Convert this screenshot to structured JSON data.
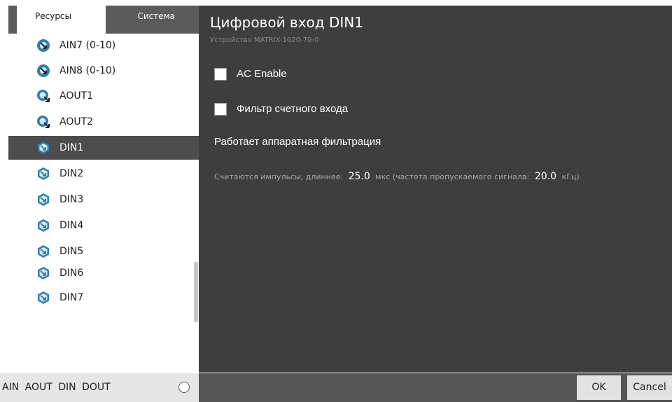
{
  "sidebar": {
    "tabs": [
      {
        "label": "Ресурсы",
        "active": true
      },
      {
        "label": "Система",
        "active": false
      }
    ],
    "items": [
      {
        "label": "AIN7 (0-10)",
        "icon": "analog-input-icon",
        "selected": false
      },
      {
        "label": "AIN8 (0-10)",
        "icon": "analog-input-icon",
        "selected": false
      },
      {
        "label": "AOUT1",
        "icon": "analog-output-icon",
        "selected": false
      },
      {
        "label": "AOUT2",
        "icon": "analog-output-icon",
        "selected": false
      },
      {
        "label": "DIN1",
        "icon": "digital-input-icon",
        "selected": true
      },
      {
        "label": "DIN2",
        "icon": "digital-input-icon",
        "selected": false
      },
      {
        "label": "DIN3",
        "icon": "digital-input-icon",
        "selected": false
      },
      {
        "label": "DIN4",
        "icon": "digital-input-icon",
        "selected": false
      },
      {
        "label": "DIN5",
        "icon": "digital-input-icon",
        "selected": false
      },
      {
        "label": "DIN6",
        "icon": "digital-input-icon",
        "selected": false
      },
      {
        "label": "DIN7",
        "icon": "digital-input-icon",
        "selected": false
      }
    ],
    "filters": [
      "AIN",
      "AOUT",
      "DIN",
      "DOUT"
    ]
  },
  "main": {
    "title": "Цифровой вход DIN1",
    "subtitle": "Устройство MATRIX-1020-70-0",
    "ac_enable_label": "AC Enable",
    "ac_enable_checked": false,
    "filter_label": "Фильтр счетного входа",
    "filter_checked": false,
    "hw_filter_text": "Работает аппаратная фильтрация",
    "pulses": {
      "prefix": "Считаются импульсы, длиннее:",
      "duration": "25.0",
      "duration_unit": "мкс",
      "freq_prefix": "(частота пропускаемого сигнала:",
      "freq": "20.0",
      "freq_unit": "кГц)"
    }
  },
  "footer": {
    "ok_label": "OK",
    "cancel_label": "Cancel"
  },
  "colors": {
    "panel_bg": "#3e3e3e",
    "selected_bg": "#4d4d4d",
    "icon_blue": "#2f7fb0",
    "footer_bg": "#545454"
  }
}
